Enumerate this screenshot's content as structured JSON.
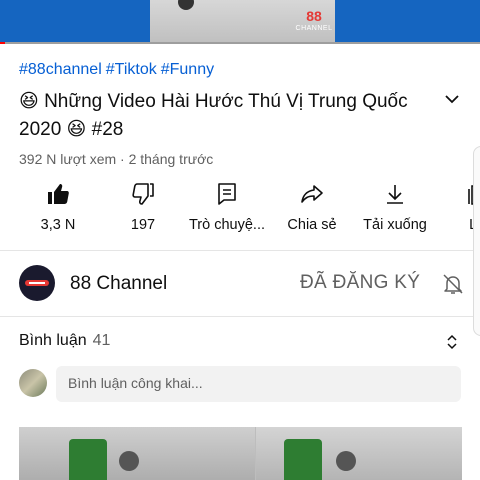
{
  "video": {
    "channel_watermark_top": "88",
    "channel_watermark_bottom": "CHANNEL",
    "progress_fraction": 0.01
  },
  "hashtags": [
    "#88channel",
    "#Tiktok",
    "#Funny"
  ],
  "title": "😆 Những Video Hài Hước Thú Vị Trung Quốc 2020 😆 #28",
  "meta": "392 N lượt xem · 2 tháng trước",
  "actions": [
    {
      "icon": "thumbs-up-filled-icon",
      "label": "3,3 N"
    },
    {
      "icon": "thumbs-down-icon",
      "label": "197"
    },
    {
      "icon": "chat-icon",
      "label": "Trò chuyệ..."
    },
    {
      "icon": "share-icon",
      "label": "Chia sẻ"
    },
    {
      "icon": "download-icon",
      "label": "Tải xuống"
    },
    {
      "icon": "save-icon",
      "label": "Lư"
    }
  ],
  "channel": {
    "name": "88 Channel",
    "subscribed_label": "ĐÃ ĐĂNG KÝ"
  },
  "comments": {
    "title": "Bình luận",
    "count": "41",
    "placeholder": "Bình luận công khai..."
  },
  "colors": {
    "link": "#065fd4",
    "progress": "#ff0000",
    "text_secondary": "#606060"
  }
}
